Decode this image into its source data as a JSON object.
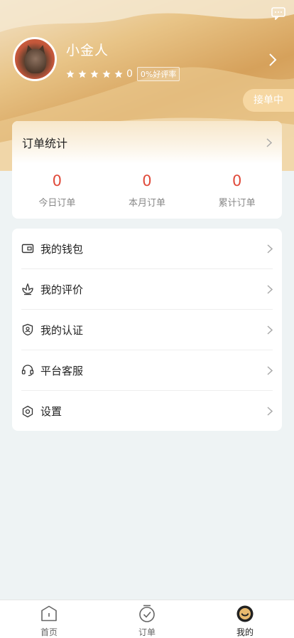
{
  "header": {
    "username": "小金人",
    "rating_value": "0",
    "good_rate": "0%好评率",
    "status": "接单中",
    "star_count": 5
  },
  "order_stats": {
    "title": "订单统计",
    "items": [
      {
        "value": "0",
        "label": "今日订单"
      },
      {
        "value": "0",
        "label": "本月订单"
      },
      {
        "value": "0",
        "label": "累计订单"
      }
    ]
  },
  "menu": {
    "items": [
      {
        "label": "我的钱包",
        "icon": "wallet-icon"
      },
      {
        "label": "我的评价",
        "icon": "flower-icon"
      },
      {
        "label": "我的认证",
        "icon": "shield-user-icon"
      },
      {
        "label": "平台客服",
        "icon": "headset-icon"
      },
      {
        "label": "设置",
        "icon": "gear-icon"
      }
    ]
  },
  "bottom_nav": {
    "items": [
      {
        "label": "首页",
        "icon": "home-icon",
        "active": false
      },
      {
        "label": "订单",
        "icon": "order-check-icon",
        "active": false
      },
      {
        "label": "我的",
        "icon": "profile-icon",
        "active": true
      }
    ]
  },
  "colors": {
    "accent_red": "#e04a3a",
    "header_gold": "#d6a15b",
    "status_pill": "#f6d7a2"
  }
}
